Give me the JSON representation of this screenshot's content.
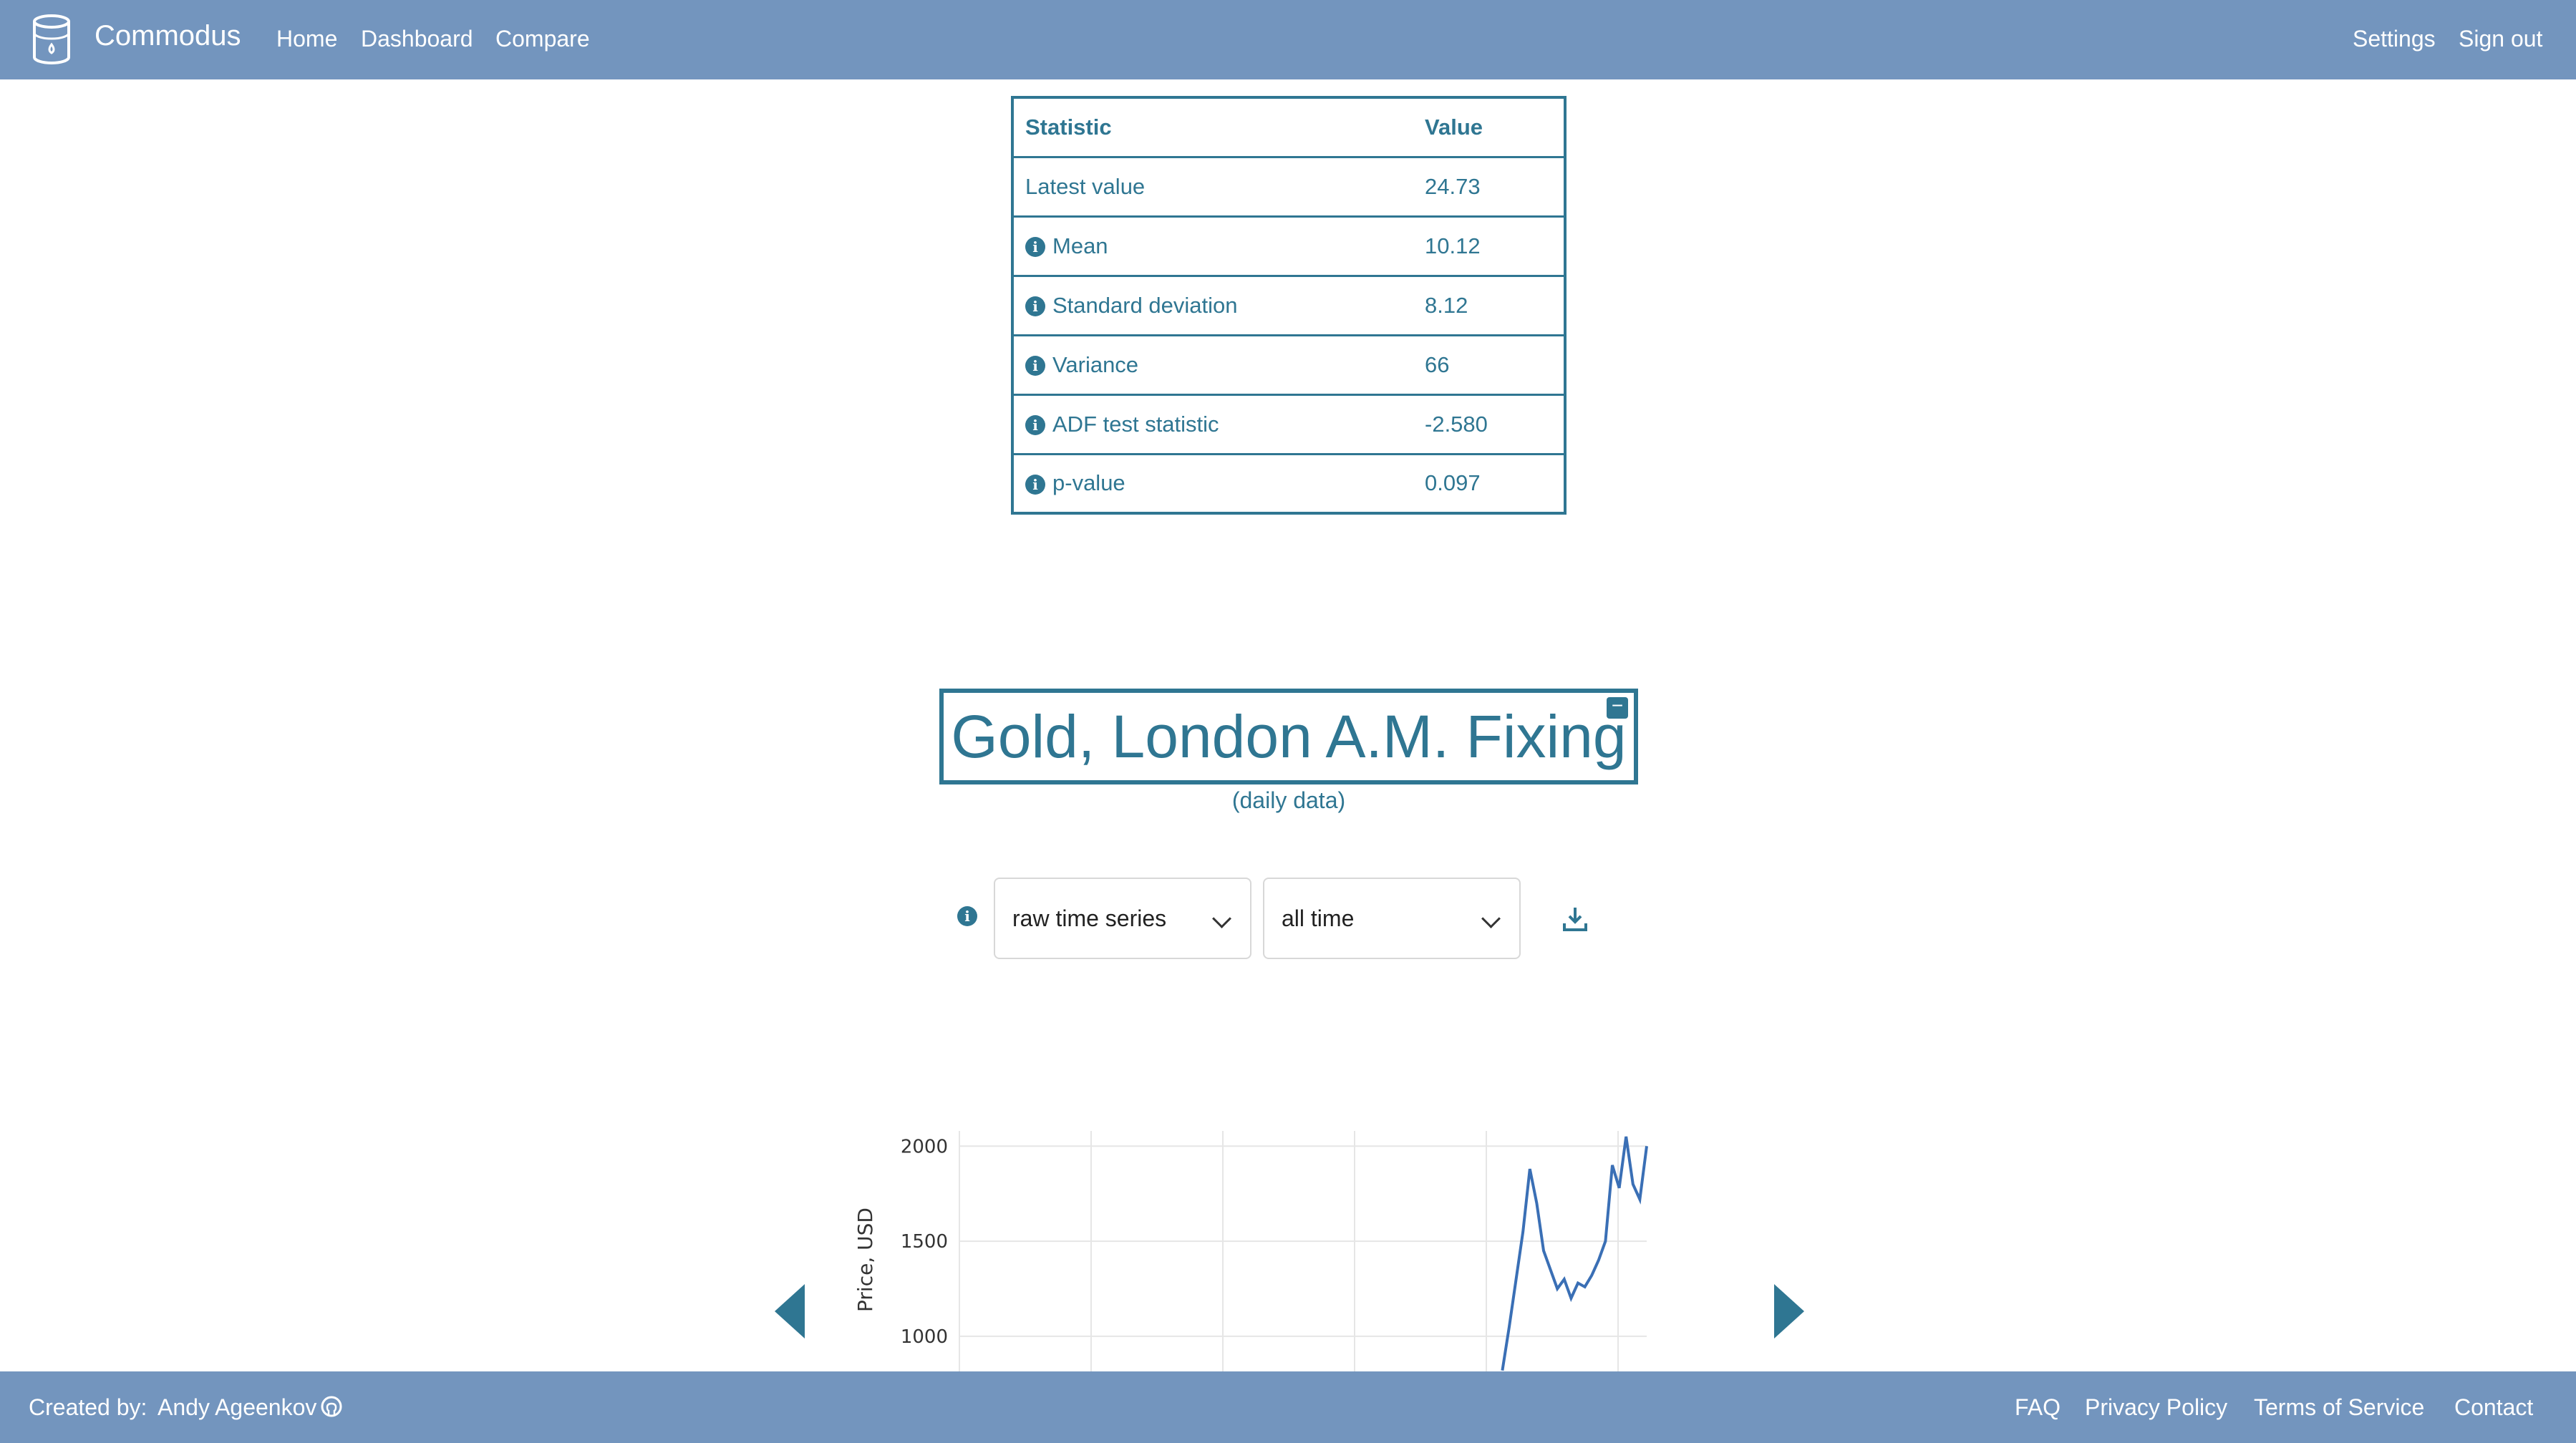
{
  "colors": {
    "nav_bg": "#7395be",
    "accent": "#2f7692",
    "line": "#3a6fb5"
  },
  "header": {
    "logo_icon": "database-icon",
    "brand": "Commodus",
    "nav": [
      "Home",
      "Dashboard",
      "Compare"
    ],
    "right": [
      "Settings",
      "Sign out"
    ]
  },
  "stats": {
    "headers": [
      "Statistic",
      "Value"
    ],
    "rows": [
      {
        "label": "Latest value",
        "value": "24.73",
        "info": false
      },
      {
        "label": "Mean",
        "value": "10.12",
        "info": true
      },
      {
        "label": "Standard deviation",
        "value": "8.12",
        "info": true
      },
      {
        "label": "Variance",
        "value": "66",
        "info": true
      },
      {
        "label": "ADF test statistic",
        "value": "-2.580",
        "info": true
      },
      {
        "label": "p-value",
        "value": "0.097",
        "info": true
      }
    ]
  },
  "series": {
    "title": "Gold, London A.M. Fixing",
    "subtitle": "(daily data)",
    "collapse_icon": "minus-icon",
    "transform_select": "raw time series",
    "range_select": "all time",
    "info_icon": "info-icon",
    "download_icon": "download-icon",
    "prev_icon": "chevron-left-icon",
    "next_icon": "chevron-right-icon"
  },
  "footer": {
    "created_by_label": "Created by:",
    "author": "Andy Ageenkov",
    "author_icon": "github-icon",
    "links": [
      "FAQ",
      "Privacy Policy",
      "Terms of Service",
      "Contact"
    ]
  },
  "chart_data": {
    "type": "line",
    "ylabel": "Price, USD",
    "y_ticks": [
      1000,
      1500,
      2000
    ],
    "ylim": [
      800,
      2080
    ],
    "x_range": [
      0,
      100
    ],
    "grid": true,
    "series": [
      {
        "x": [
          79,
          80,
          81,
          82,
          83,
          84,
          85,
          86,
          87,
          88,
          89,
          90,
          91,
          92,
          93,
          94,
          95,
          96,
          97,
          98,
          99,
          100
        ],
        "values": [
          820,
          1050,
          1300,
          1550,
          1880,
          1700,
          1450,
          1350,
          1250,
          1300,
          1200,
          1280,
          1260,
          1320,
          1400,
          1500,
          1900,
          1780,
          2050,
          1800,
          1720,
          2000
        ]
      }
    ]
  }
}
